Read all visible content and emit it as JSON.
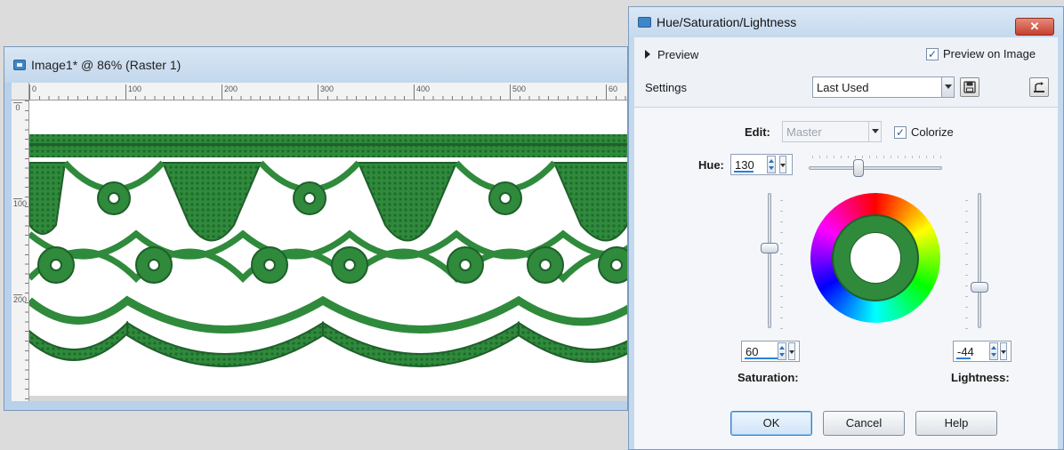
{
  "image_window": {
    "title": "Image1* @ 86% (Raster 1)",
    "ruler_h_labels": [
      "0",
      "100",
      "200",
      "300",
      "400",
      "500",
      "60"
    ],
    "ruler_v_labels": [
      "0",
      "100",
      "200"
    ]
  },
  "dialog": {
    "title": "Hue/Saturation/Lightness",
    "close_label": "✕",
    "preview_label": "Preview",
    "preview_on_image_label": "Preview on Image",
    "preview_on_image_checked": "✓",
    "settings_label": "Settings",
    "settings_value": "Last Used",
    "edit_label": "Edit:",
    "edit_value": "Master",
    "colorize_label": "Colorize",
    "colorize_checked": "✓",
    "hue_label": "Hue:",
    "hue_value": "130",
    "saturation_label": "Saturation:",
    "saturation_value": "60",
    "lightness_label": "Lightness:",
    "lightness_value": "-44",
    "ok_label": "OK",
    "cancel_label": "Cancel",
    "help_label": "Help"
  },
  "colors": {
    "lace_green": "#2f8a3c",
    "lace_dark": "#1f5f2a"
  }
}
